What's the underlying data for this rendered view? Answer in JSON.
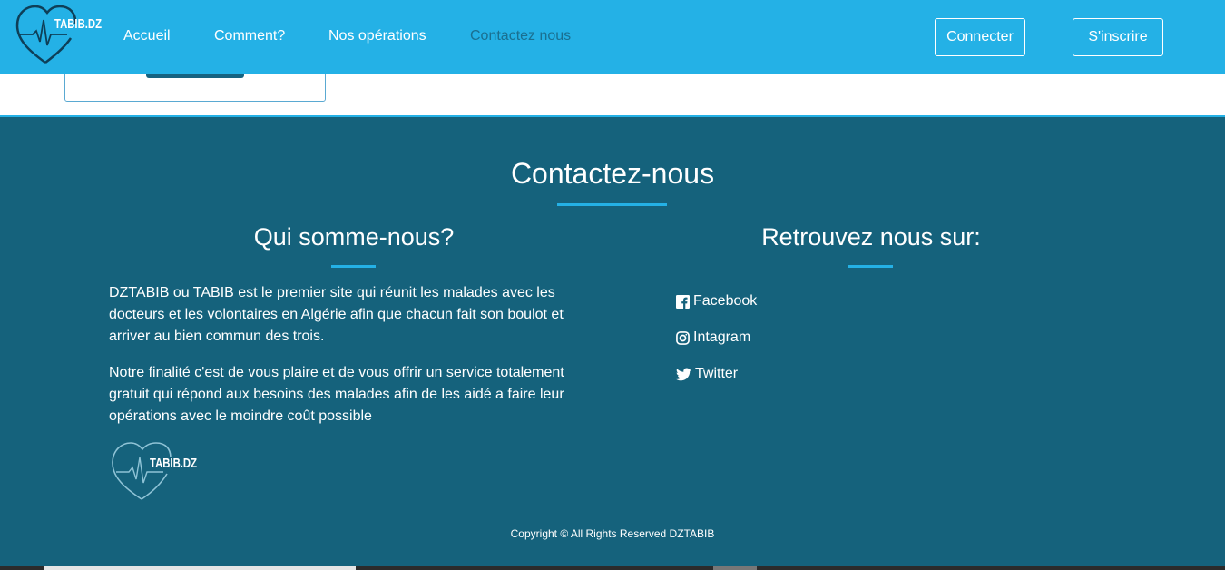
{
  "brand": {
    "logo_text": "TABIB.DZ"
  },
  "nav": {
    "links": [
      "Accueil",
      "Comment?",
      "Nos opérations",
      "Contactez nous"
    ],
    "active_index": 3,
    "login_label": "Connecter",
    "signup_label": "S'inscrire"
  },
  "footer": {
    "title": "Contactez-nous",
    "about": {
      "title": "Qui somme-nous?",
      "paragraphs": [
        "DZTABIB ou TABIB est le premier site qui réunit les malades avec les docteurs et les volontaires en Algérie afin que chacun fait son boulot et arriver au bien commun des trois.",
        "Notre finalité c'est de vous plaire et de vous offrir un service totalement gratuit qui répond aux besoins des malades afin de les aidé a faire leur opérations avec le moindre coût possible"
      ],
      "logo_text": "TABIB.DZ"
    },
    "social": {
      "title": "Retrouvez nous sur:",
      "items": [
        {
          "label": "Facebook",
          "icon": "facebook-icon"
        },
        {
          "label": "Intagram",
          "icon": "instagram-icon"
        },
        {
          "label": "Twitter",
          "icon": "twitter-icon"
        }
      ]
    },
    "copyright": "Copyright © All Rights Reserved DZTABIB"
  },
  "colors": {
    "navbar": "#24b1e6",
    "footer": "#15627c",
    "accent": "#24b1e6",
    "active_link": "#1a6f90"
  }
}
